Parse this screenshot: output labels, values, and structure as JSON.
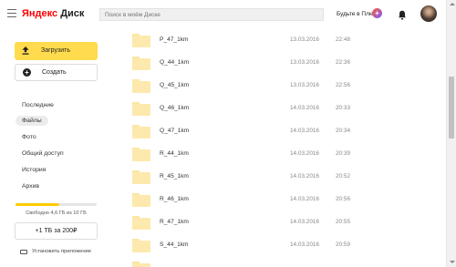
{
  "header": {
    "logo_brand": "Яндекс",
    "logo_product": "Диск",
    "search_placeholder": "Поиск в моём Диске",
    "plus_label": "Будьте в Плюсе",
    "plus_badge": "+"
  },
  "sidebar": {
    "upload_label": "Загрузить",
    "create_label": "Создать",
    "nav": [
      {
        "label": "Последние",
        "active": false
      },
      {
        "label": "Файлы",
        "active": true
      },
      {
        "label": "Фото",
        "active": false
      },
      {
        "label": "Общий доступ",
        "active": false
      },
      {
        "label": "История",
        "active": false
      },
      {
        "label": "Архив",
        "active": false
      }
    ],
    "storage_text": "Свободно 4,6 ГБ из 10 ГБ",
    "storage_used_fraction": 0.54,
    "buy_label": "+1 ТБ за 200₽",
    "install_label": "Установить приложение"
  },
  "files": [
    {
      "name": "P_47_1km",
      "date": "13.03.2016",
      "time": "22:48"
    },
    {
      "name": "Q_44_1km",
      "date": "13.03.2016",
      "time": "22:36"
    },
    {
      "name": "Q_45_1km",
      "date": "13.03.2016",
      "time": "22:56"
    },
    {
      "name": "Q_46_1km",
      "date": "14.03.2016",
      "time": "20:33"
    },
    {
      "name": "Q_47_1km",
      "date": "14.03.2016",
      "time": "20:34"
    },
    {
      "name": "R_44_1km",
      "date": "14.03.2016",
      "time": "20:39"
    },
    {
      "name": "R_45_1km",
      "date": "14.03.2016",
      "time": "20:52"
    },
    {
      "name": "R_46_1km",
      "date": "14.03.2016",
      "time": "20:56"
    },
    {
      "name": "R_47_1km",
      "date": "14.03.2016",
      "time": "20:55"
    },
    {
      "name": "S_44_1km",
      "date": "14.03.2016",
      "time": "20:59"
    },
    {
      "name": "",
      "date": "",
      "time": ""
    }
  ],
  "colors": {
    "accent": "#ffdb4d",
    "folder": "#fde9ad",
    "storage_fill": "#ffcc00"
  }
}
